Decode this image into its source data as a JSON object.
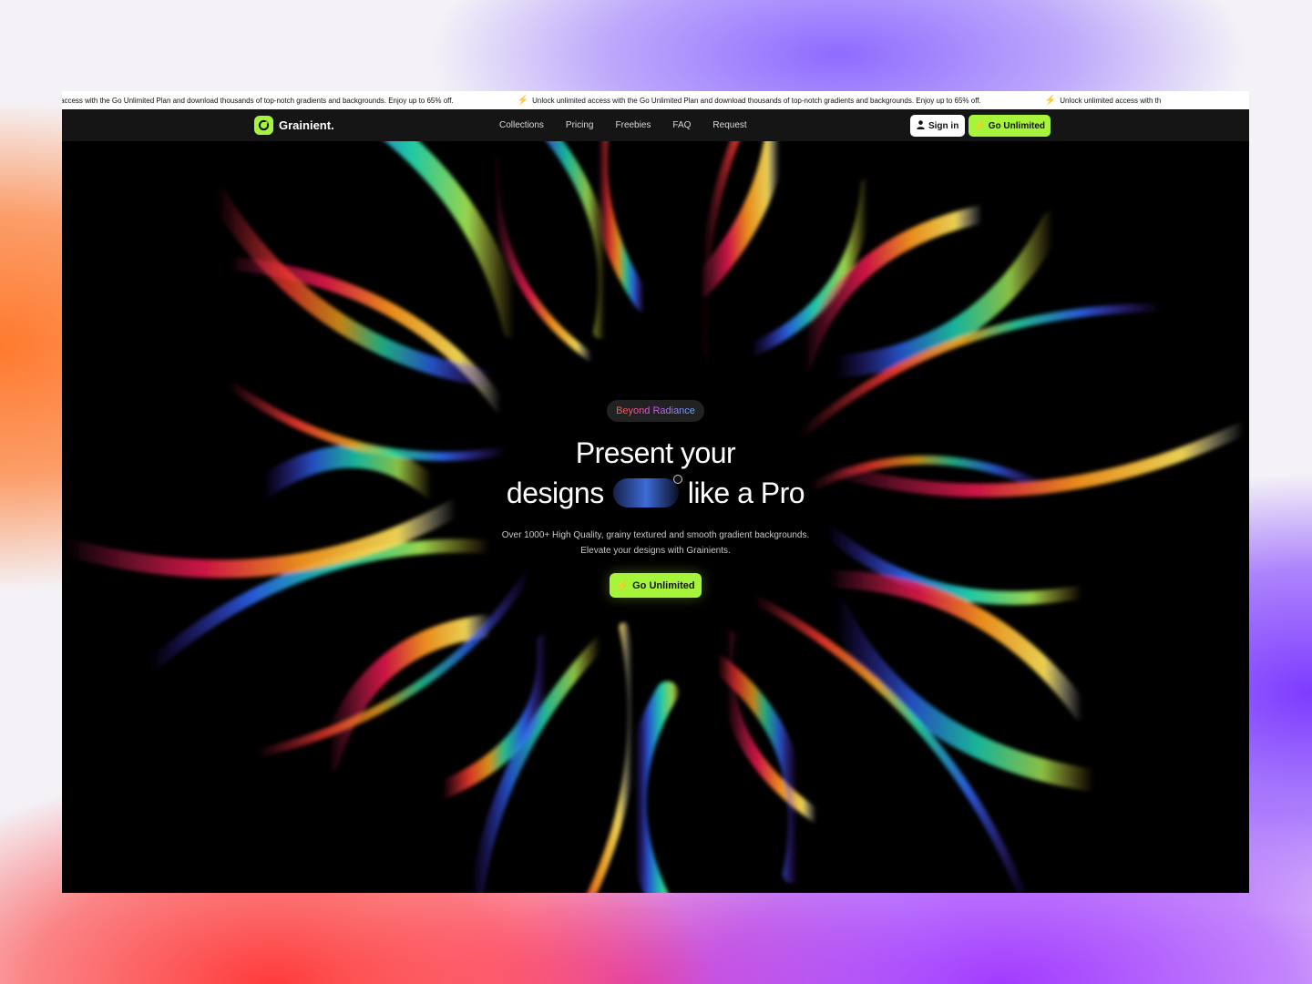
{
  "announcement": {
    "segments": [
      "access with the Go Unlimited Plan and download thousands of top-notch gradients and backgrounds. Enjoy up to 65% off.",
      "Unlock unlimited access with the Go Unlimited Plan and download thousands of top-notch gradients and backgrounds. Enjoy up to 65% off.",
      "Unlock unlimited access with th"
    ],
    "icon": "bolt-icon"
  },
  "nav": {
    "brand": "Grainient.",
    "links": [
      "Collections",
      "Pricing",
      "Freebies",
      "FAQ",
      "Request"
    ],
    "sign_in": "Sign in",
    "go_unlimited": "Go Unlimited"
  },
  "hero": {
    "badge": "Beyond Radiance",
    "headline_line1": "Present your",
    "headline_word_left": "designs",
    "headline_word_right": "like a Pro",
    "subtitle_line1": "Over 1000+ High Quality, grainy textured and smooth gradient backgrounds.",
    "subtitle_line2": "Elevate your designs with Grainients.",
    "cta": "Go Unlimited"
  },
  "colors": {
    "accent": "#a6f53a",
    "nav_bg": "#151515",
    "hero_bg": "#000000"
  }
}
